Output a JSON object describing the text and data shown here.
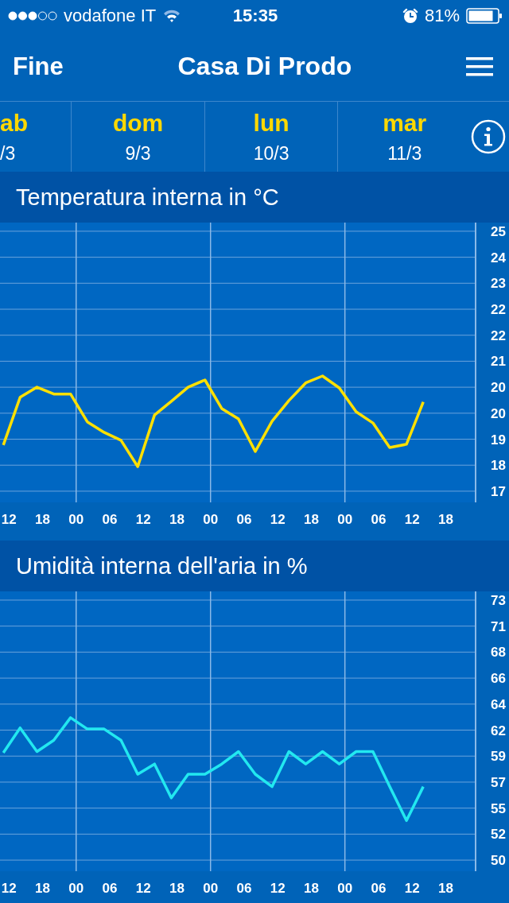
{
  "status_bar": {
    "carrier": "vodafone IT",
    "time": "15:35",
    "battery": "81%"
  },
  "nav": {
    "back": "Fine",
    "title": "Casa Di Prodo"
  },
  "days": [
    {
      "weekday": "ab",
      "date": "/3"
    },
    {
      "weekday": "dom",
      "date": "9/3"
    },
    {
      "weekday": "lun",
      "date": "10/3"
    },
    {
      "weekday": "mar",
      "date": "11/3"
    }
  ],
  "charts": [
    {
      "chart_data": {
        "type": "line",
        "title": "Temperatura interna in °C",
        "grid": true,
        "x": [
          11,
          14,
          17,
          20,
          23,
          26,
          29,
          32,
          35,
          38,
          41,
          44,
          47,
          50,
          53,
          56,
          59,
          62,
          65,
          68,
          71,
          74,
          77,
          80,
          83,
          86
        ],
        "xlim": [
          10.4,
          95.2
        ],
        "ylim": [
          17.09,
          24.84
        ],
        "series": [
          {
            "color": "#ffe000",
            "values": [
              18.68,
              20.0,
              20.28,
              20.09,
              20.09,
              19.32,
              19.03,
              18.81,
              18.08,
              19.51,
              19.89,
              20.28,
              20.48,
              19.69,
              19.4,
              18.5,
              19.34,
              19.91,
              20.4,
              20.59,
              20.26,
              19.6,
              19.29,
              18.61,
              18.7,
              19.87
            ]
          }
        ],
        "ref_lines": [
          {
            "axis": "x",
            "value": 24
          },
          {
            "axis": "x",
            "value": 48
          },
          {
            "axis": "x",
            "value": 72
          }
        ],
        "xticks": [
          {
            "value": 12,
            "label": "12"
          },
          {
            "value": 18,
            "label": "18"
          },
          {
            "value": 24,
            "label": "00"
          },
          {
            "value": 30,
            "label": "06"
          },
          {
            "value": 36,
            "label": "12"
          },
          {
            "value": 42,
            "label": "18"
          },
          {
            "value": 48,
            "label": "00"
          },
          {
            "value": 54,
            "label": "06"
          },
          {
            "value": 60,
            "label": "12"
          },
          {
            "value": 66,
            "label": "18"
          },
          {
            "value": 72,
            "label": "00"
          },
          {
            "value": 78,
            "label": "06"
          },
          {
            "value": 84,
            "label": "12"
          },
          {
            "value": 90,
            "label": "18"
          }
        ],
        "yticks": [
          {
            "value": 24.6,
            "label": "25"
          },
          {
            "value": 23.88,
            "label": "24"
          },
          {
            "value": 23.16,
            "label": "23"
          },
          {
            "value": 22.44,
            "label": "22"
          },
          {
            "value": 21.72,
            "label": "22"
          },
          {
            "value": 21.0,
            "label": "21"
          },
          {
            "value": 20.28,
            "label": "20"
          },
          {
            "value": 19.56,
            "label": "20"
          },
          {
            "value": 18.84,
            "label": "19"
          },
          {
            "value": 18.12,
            "label": "18"
          },
          {
            "value": 17.4,
            "label": "17"
          }
        ]
      }
    },
    {
      "chart_data": {
        "type": "line",
        "title": "Umidità interna dell'aria in %",
        "grid": true,
        "x": [
          11,
          14,
          17,
          20,
          23,
          26,
          29,
          32,
          35,
          38,
          41,
          44,
          47,
          50,
          53,
          56,
          59,
          62,
          65,
          68,
          71,
          74,
          77,
          80,
          83,
          86
        ],
        "xlim": [
          10.4,
          95.2
        ],
        "ylim": [
          49.02,
          73.77
        ],
        "series": [
          {
            "color": "#22e8f0",
            "values": [
              59.5,
              61.7,
              59.6,
              60.6,
              62.6,
              61.6,
              61.6,
              60.6,
              57.6,
              58.5,
              55.5,
              57.6,
              57.6,
              58.5,
              59.6,
              57.6,
              56.5,
              59.6,
              58.5,
              59.6,
              58.5,
              59.6,
              59.6,
              56.5,
              53.5,
              56.5
            ]
          }
        ],
        "ref_lines": [
          {
            "axis": "x",
            "value": 24
          },
          {
            "axis": "x",
            "value": 48
          },
          {
            "axis": "x",
            "value": 72
          }
        ],
        "xticks": [
          {
            "value": 12,
            "label": "12"
          },
          {
            "value": 18,
            "label": "18"
          },
          {
            "value": 24,
            "label": "00"
          },
          {
            "value": 30,
            "label": "06"
          },
          {
            "value": 36,
            "label": "12"
          },
          {
            "value": 42,
            "label": "18"
          },
          {
            "value": 48,
            "label": "00"
          },
          {
            "value": 54,
            "label": "06"
          },
          {
            "value": 60,
            "label": "12"
          },
          {
            "value": 66,
            "label": "18"
          },
          {
            "value": 72,
            "label": "00"
          },
          {
            "value": 78,
            "label": "06"
          },
          {
            "value": 84,
            "label": "12"
          },
          {
            "value": 90,
            "label": "18"
          }
        ],
        "yticks": [
          {
            "value": 73,
            "label": "73"
          },
          {
            "value": 70.7,
            "label": "71"
          },
          {
            "value": 68.4,
            "label": "68"
          },
          {
            "value": 66.1,
            "label": "66"
          },
          {
            "value": 63.8,
            "label": "64"
          },
          {
            "value": 61.5,
            "label": "62"
          },
          {
            "value": 59.2,
            "label": "59"
          },
          {
            "value": 56.9,
            "label": "57"
          },
          {
            "value": 54.6,
            "label": "55"
          },
          {
            "value": 52.3,
            "label": "52"
          },
          {
            "value": 50,
            "label": "50"
          }
        ]
      }
    }
  ]
}
